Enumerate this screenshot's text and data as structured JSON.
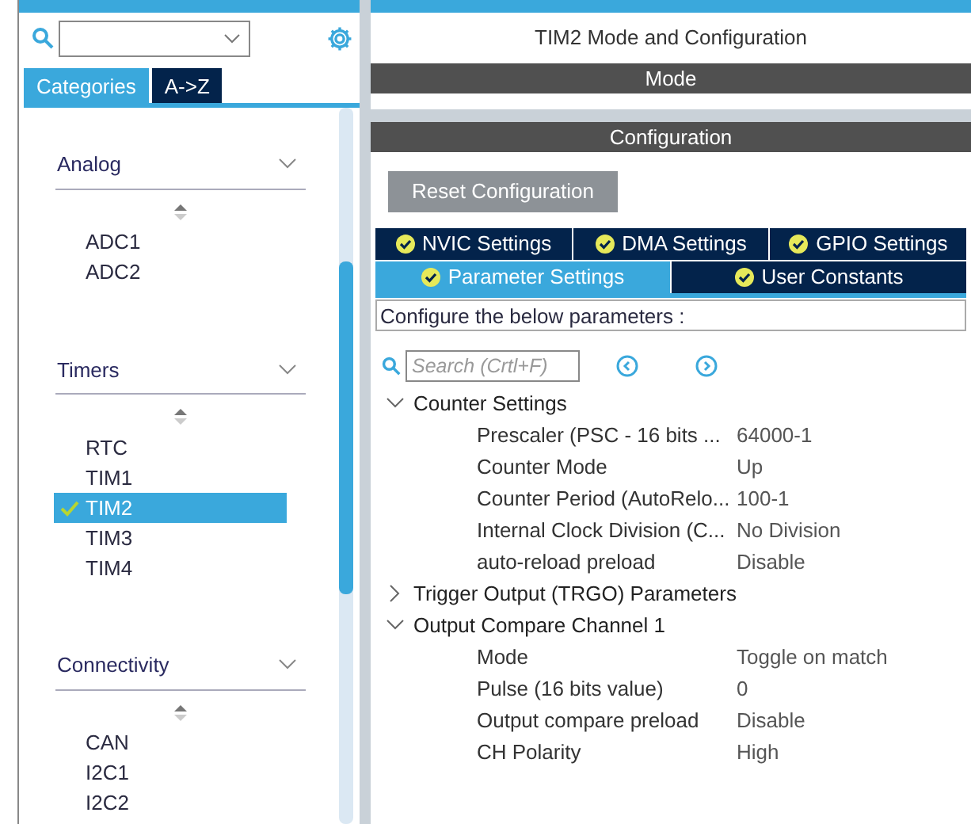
{
  "sidebar": {
    "tabs": [
      {
        "label": "Categories",
        "selected": true
      },
      {
        "label": "A->Z",
        "selected": false
      }
    ],
    "groups": [
      {
        "title": "Analog",
        "expanded": true,
        "items": [
          {
            "label": "ADC1",
            "selected": false,
            "checked": false
          },
          {
            "label": "ADC2",
            "selected": false,
            "checked": false
          }
        ]
      },
      {
        "title": "Timers",
        "expanded": true,
        "items": [
          {
            "label": "RTC",
            "selected": false,
            "checked": false
          },
          {
            "label": "TIM1",
            "selected": false,
            "checked": false
          },
          {
            "label": "TIM2",
            "selected": true,
            "checked": true
          },
          {
            "label": "TIM3",
            "selected": false,
            "checked": false
          },
          {
            "label": "TIM4",
            "selected": false,
            "checked": false
          }
        ]
      },
      {
        "title": "Connectivity",
        "expanded": true,
        "items": [
          {
            "label": "CAN",
            "selected": false,
            "checked": false
          },
          {
            "label": "I2C1",
            "selected": false,
            "checked": false
          },
          {
            "label": "I2C2",
            "selected": false,
            "checked": false
          }
        ]
      }
    ]
  },
  "main": {
    "title": "TIM2 Mode and Configuration",
    "mode_header": "Mode",
    "config_header": "Configuration",
    "reset_button": "Reset Configuration",
    "tabs": [
      [
        {
          "label": "NVIC Settings",
          "selected": false
        },
        {
          "label": "DMA Settings",
          "selected": false
        },
        {
          "label": "GPIO Settings",
          "selected": false
        }
      ],
      [
        {
          "label": "Parameter Settings",
          "selected": true
        },
        {
          "label": "User Constants",
          "selected": false
        }
      ]
    ],
    "hint": "Configure the below parameters :",
    "search": {
      "placeholder": "Search (Crtl+F)"
    },
    "tree": [
      {
        "label": "Counter Settings",
        "expanded": true,
        "children": [
          {
            "label": "Prescaler (PSC - 16 bits ...",
            "value": "64000-1"
          },
          {
            "label": "Counter Mode",
            "value": "Up"
          },
          {
            "label": "Counter Period (AutoRelo...",
            "value": "100-1"
          },
          {
            "label": "Internal Clock Division (C...",
            "value": "No Division"
          },
          {
            "label": "auto-reload preload",
            "value": "Disable"
          }
        ]
      },
      {
        "label": "Trigger Output (TRGO) Parameters",
        "expanded": false
      },
      {
        "label": "Output Compare Channel 1",
        "expanded": true,
        "children": [
          {
            "label": "Mode",
            "value": "Toggle on match"
          },
          {
            "label": "Pulse (16 bits value)",
            "value": "0"
          },
          {
            "label": "Output compare preload",
            "value": "Disable"
          },
          {
            "label": "CH Polarity",
            "value": "High"
          }
        ]
      }
    ]
  }
}
